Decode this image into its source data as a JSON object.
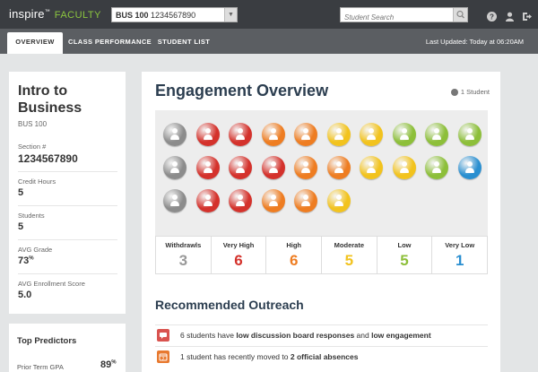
{
  "app": {
    "brand": "inspire",
    "trademark": "™",
    "product": "FACULTY"
  },
  "course_select": {
    "code": "BUS 100",
    "section": "1234567890"
  },
  "search": {
    "placeholder": "Student Search"
  },
  "nav": {
    "tabs": [
      {
        "label": "OVERVIEW",
        "active": true
      },
      {
        "label": "CLASS PERFORMANCE",
        "active": false
      },
      {
        "label": "STUDENT LIST",
        "active": false
      }
    ],
    "last_updated": "Last Updated: Today at 06:20AM"
  },
  "course": {
    "title": "Intro to Business",
    "code": "BUS 100",
    "stats": [
      {
        "label": "Section #",
        "value": "1234567890"
      },
      {
        "label": "Credit Hours",
        "value": "5"
      },
      {
        "label": "Students",
        "value": "5"
      },
      {
        "label": "AVG Grade",
        "value": "73",
        "suffix": "%"
      },
      {
        "label": "AVG Enrollment Score",
        "value": "5.0"
      }
    ]
  },
  "predictors": {
    "title": "Top Predictors",
    "items": [
      {
        "label": "Prior Term GPA",
        "value": "89",
        "suffix": "%"
      }
    ]
  },
  "engagement": {
    "title": "Engagement Overview",
    "student_count": "1 Student",
    "rows": [
      [
        "gray",
        "red",
        "red",
        "orange",
        "orange",
        "yellow",
        "yellow",
        "green",
        "green",
        "green"
      ],
      [
        "gray",
        "red",
        "red",
        "red",
        "orange",
        "orange",
        "yellow",
        "yellow",
        "green",
        "blue"
      ],
      [
        "gray",
        "red",
        "red",
        "orange",
        "orange",
        "yellow"
      ]
    ],
    "colors": {
      "gray": "#8c8c8c",
      "red": "#d4322c",
      "orange": "#ee7d22",
      "yellow": "#f2c31e",
      "green": "#8dbf3a",
      "blue": "#2a8fd0"
    },
    "levels": [
      {
        "label": "Withdrawls",
        "count": "3",
        "color": "#999999"
      },
      {
        "label": "Very High",
        "count": "6",
        "color": "#d4322c"
      },
      {
        "label": "High",
        "count": "6",
        "color": "#ee7d22"
      },
      {
        "label": "Moderate",
        "count": "5",
        "color": "#f2c31e"
      },
      {
        "label": "Low",
        "count": "5",
        "color": "#8dbf3a"
      },
      {
        "label": "Very Low",
        "count": "1",
        "color": "#2a8fd0"
      }
    ]
  },
  "outreach": {
    "title": "Recommended Outreach",
    "items": [
      {
        "icon": "chat-icon",
        "pre": "6 students have ",
        "b1": "low discussion board responses",
        "mid": " and ",
        "b2": "low engagement"
      },
      {
        "icon": "calendar-icon",
        "pre": "1 student has recently moved to ",
        "b1": "2 official absences",
        "mid": "",
        "b2": ""
      }
    ]
  }
}
